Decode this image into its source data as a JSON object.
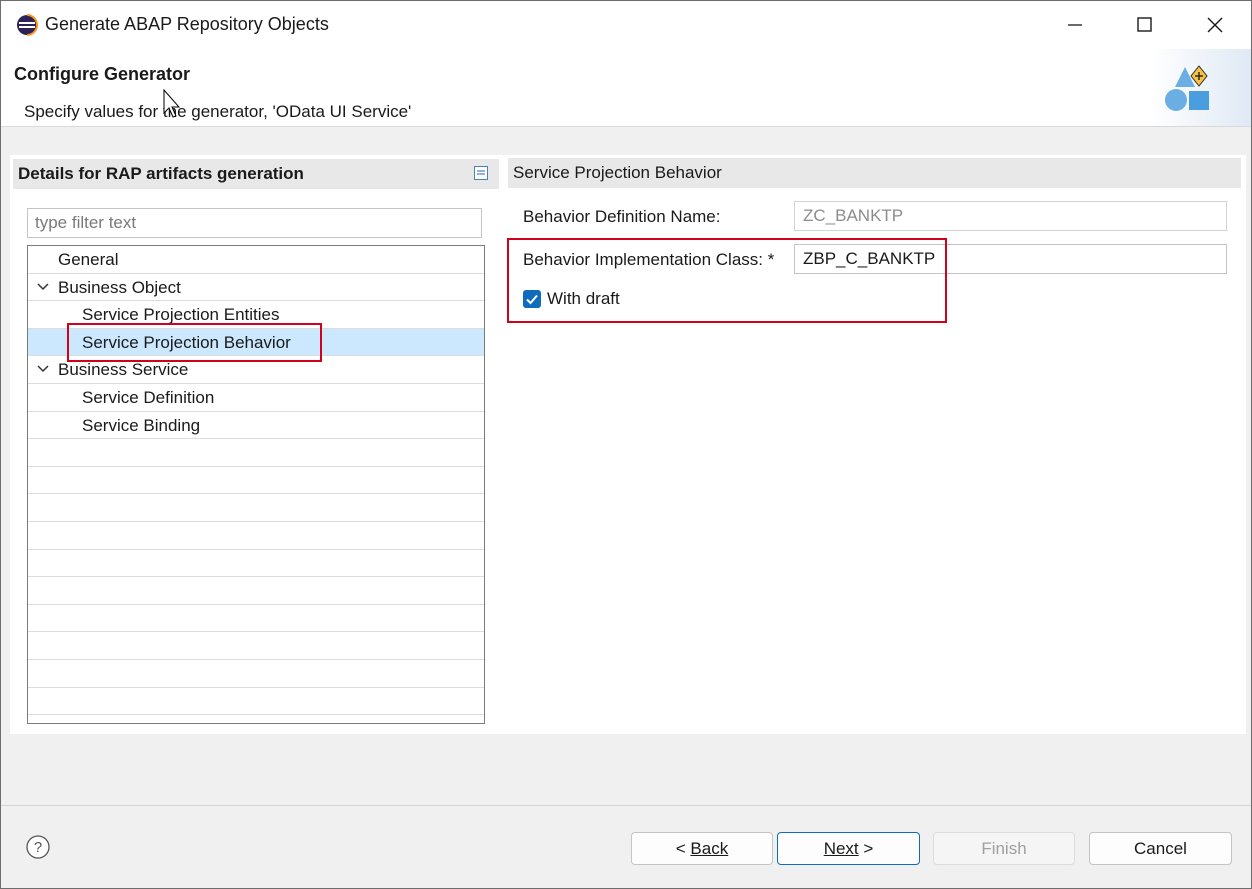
{
  "window": {
    "title": "Generate ABAP Repository Objects",
    "controls": [
      "minimize-icon",
      "maximize-icon",
      "close-icon"
    ]
  },
  "banner": {
    "title": "Configure Generator",
    "subtitle": "Specify values for the generator, 'OData UI Service'"
  },
  "left_panel": {
    "title": "Details for RAP artifacts generation",
    "filter_placeholder": "type filter text",
    "tree": [
      {
        "label": "General",
        "level": 0,
        "expandable": false
      },
      {
        "label": "Business Object",
        "level": 0,
        "expandable": true,
        "expanded": true
      },
      {
        "label": "Service Projection Entities",
        "level": 1,
        "expandable": false
      },
      {
        "label": "Service Projection Behavior",
        "level": 1,
        "expandable": false,
        "selected": true
      },
      {
        "label": "Business Service",
        "level": 0,
        "expandable": true,
        "expanded": true
      },
      {
        "label": "Service Definition",
        "level": 1,
        "expandable": false
      },
      {
        "label": "Service Binding",
        "level": 1,
        "expandable": false
      }
    ]
  },
  "right_panel": {
    "title": "Service Projection Behavior",
    "behavior_definition_label": "Behavior Definition Name:",
    "behavior_definition_value": "ZC_BANKTP",
    "implementation_class_label": "Behavior Implementation Class: *",
    "implementation_class_value": "ZBP_C_BANKTP",
    "with_draft_label": "With draft",
    "with_draft_checked": true
  },
  "footer": {
    "back_label": "Back",
    "next_label": "Next",
    "finish_label": "Finish",
    "cancel_label": "Cancel"
  },
  "colors": {
    "selection": "#cce8ff",
    "highlight_box": "#d0021b",
    "accent": "#0f6cbd"
  }
}
